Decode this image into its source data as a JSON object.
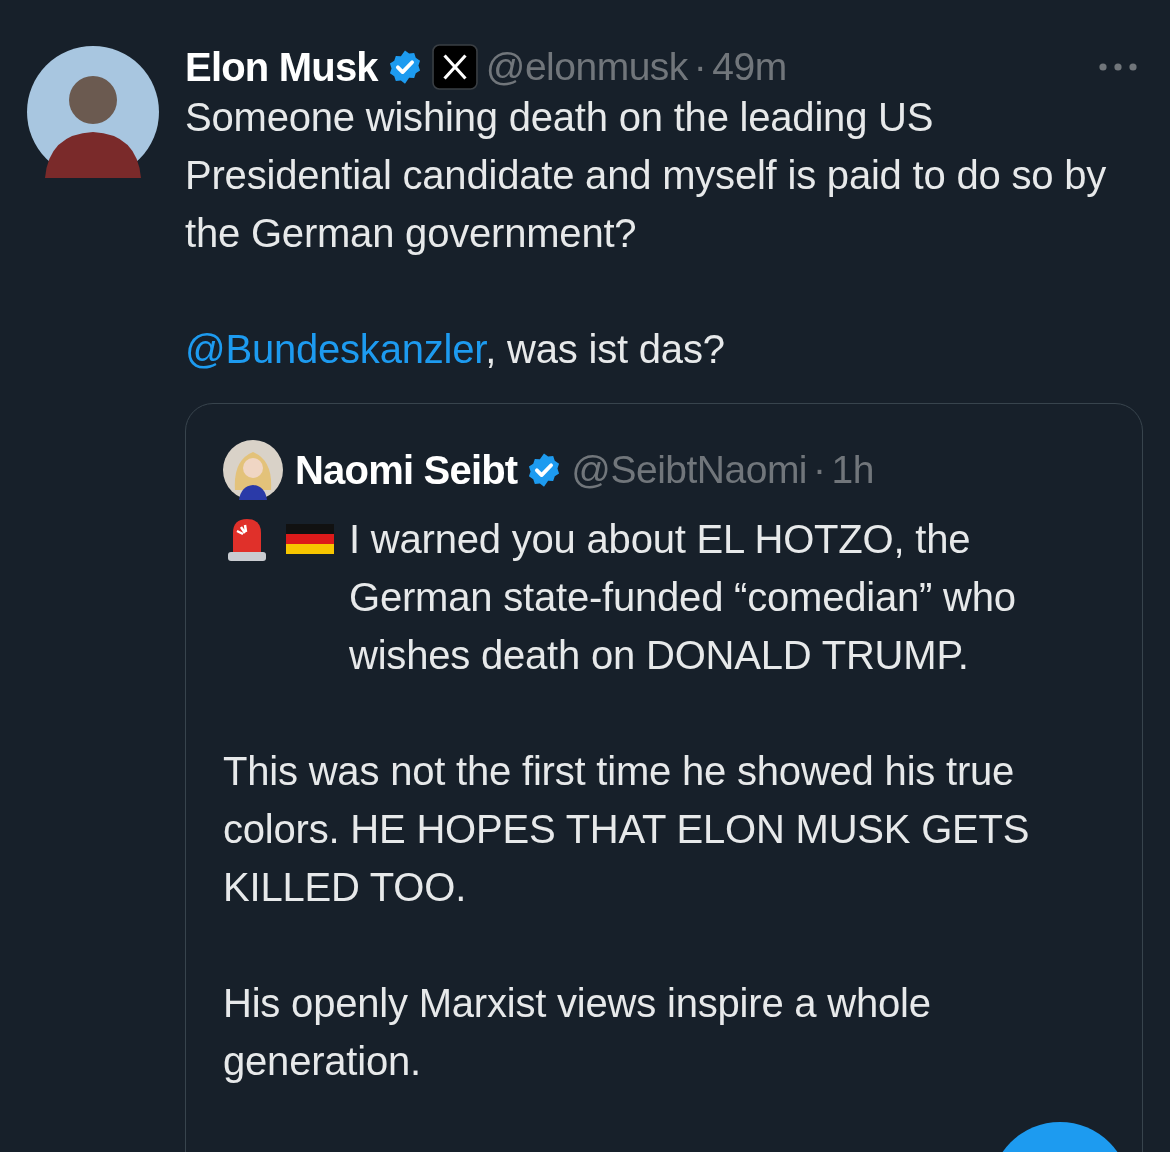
{
  "tweet": {
    "author": {
      "name": "Elon Musk",
      "verified": true,
      "affiliate_badge": true,
      "handle": "@elonmusk",
      "separator": "·",
      "time": "49m"
    },
    "paragraphs": [
      {
        "kind": "plain",
        "text": "Someone wishing death on the leading US Presidential candidate and myself is paid to do so by the German government?"
      },
      {
        "kind": "mention",
        "mention": "@Bundeskanzler",
        "text": ", was ist das?"
      }
    ],
    "quote": {
      "author": {
        "name": "Naomi Seibt",
        "verified": true,
        "handle": "@SeibtNaomi",
        "separator": "·",
        "time": "1h"
      },
      "paragraphs": [
        {
          "kind": "emoji",
          "text": "I warned you about EL HOTZO, the German state-funded “comedian” who wishes death on DONALD TRUMP."
        },
        {
          "kind": "plain",
          "text": "This was not the first time he showed his true colors. HE HOPES THAT ELON MUSK GETS KILLED TOO."
        },
        {
          "kind": "plain",
          "text": "His openly Marxist views inspire a whole generation."
        }
      ]
    }
  }
}
